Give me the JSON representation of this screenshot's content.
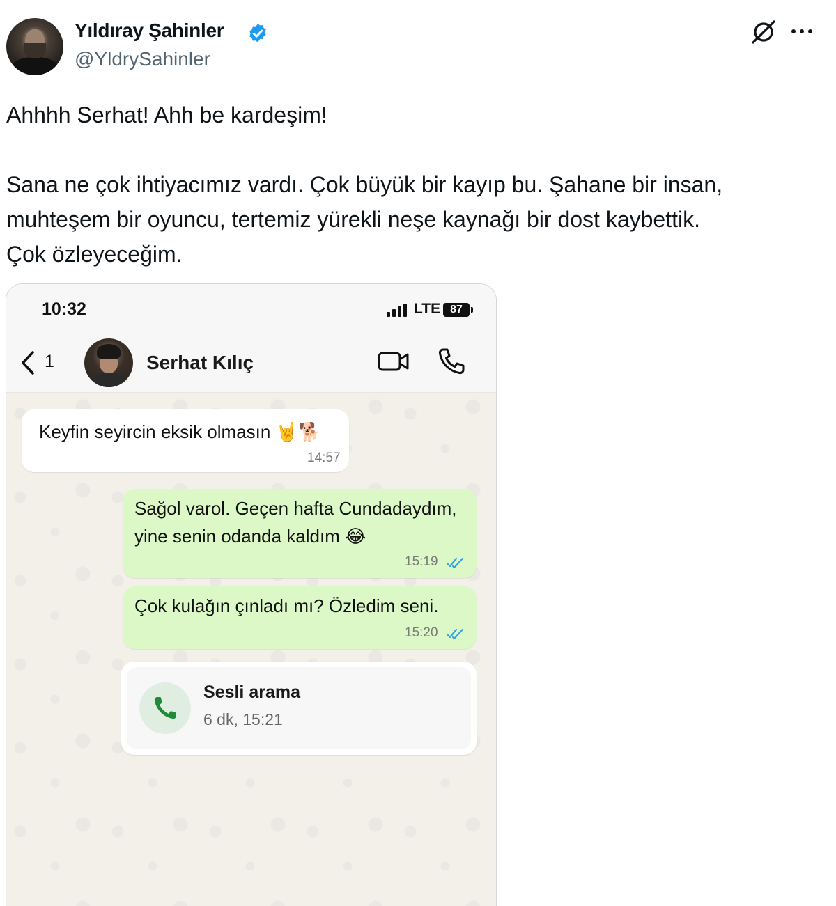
{
  "tweet": {
    "author_name": "Yıldıray Şahinler",
    "author_handle": "@YldrySahinler",
    "text": "Ahhhh Serhat! Ahh be kardeşim!\n\nSana ne çok ihtiyacımız vardı. Çok büyük bir kayıp bu. Şahane bir insan,\nmuhteşem bir oyuncu, tertemiz yürekli neşe kaynağı bir dost kaybettik.\nÇok özleyeceğim."
  },
  "icons": {
    "verified": "verified-badge-icon",
    "grok": "grok-icon",
    "more": "more-options-icon"
  },
  "phone": {
    "status_time": "10:32",
    "network": "LTE",
    "battery": "87",
    "back_count": "1",
    "contact_name": "Serhat Kılıç",
    "messages": [
      {
        "direction": "incoming",
        "text": "Keyfin seyircin eksik olmasın",
        "emoji": "🤘🐕",
        "time": "14:57"
      },
      {
        "direction": "outgoing",
        "text": "Sağol varol. Geçen hafta Cundadaydım,\nyine senin odanda kaldım",
        "emoji": "😂",
        "time": "15:19",
        "read": true
      },
      {
        "direction": "outgoing",
        "text": "Çok kulağın çınladı mı? Özledim seni.",
        "time": "15:20",
        "read": true
      }
    ],
    "call": {
      "title": "Sesli arama",
      "detail": "6 dk, 15:21"
    }
  },
  "colors": {
    "verified_blue": "#1d9bf0",
    "outgoing_bubble": "#dcf8c6",
    "read_ticks": "#34a3e0",
    "call_green": "#1f8a3a"
  }
}
